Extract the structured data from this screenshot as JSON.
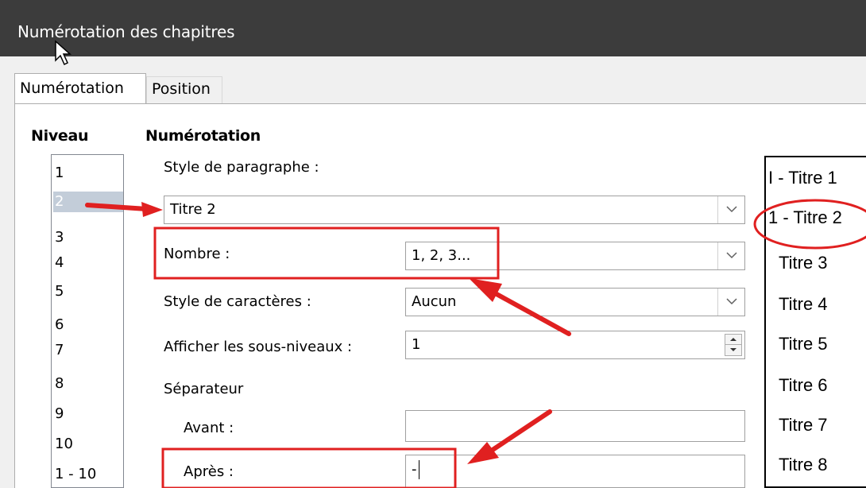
{
  "window": {
    "title": "Numérotation des chapitres"
  },
  "tabs": [
    {
      "label": "Numérotation",
      "active": true
    },
    {
      "label": "Position",
      "active": false
    }
  ],
  "level_section": {
    "heading": "Niveau",
    "items": [
      "1",
      "2",
      "3",
      "4",
      "5",
      "6",
      "7",
      "8",
      "9",
      "10",
      "1 - 10"
    ],
    "selected": "2"
  },
  "numbering_section": {
    "heading": "Numérotation",
    "paragraph_style_label": "Style de paragraphe :",
    "paragraph_style_value": "Titre 2",
    "number_label": "Nombre :",
    "number_value": "1, 2, 3...",
    "char_style_label": "Style de caractères :",
    "char_style_value": "Aucun",
    "sublevels_label": "Afficher les sous-niveaux :",
    "sublevels_value": "1",
    "separator_label": "Séparateur",
    "before_label": "Avant :",
    "before_value": "",
    "after_label": "Après :",
    "after_value": "-"
  },
  "preview": {
    "items": [
      "I - Titre 1",
      "1 - Titre 2",
      "Titre 3",
      "Titre 4",
      "Titre 5",
      "Titre 6",
      "Titre 7",
      "Titre 8"
    ]
  },
  "colors": {
    "annotation": "#e02020",
    "titlebar": "#3c3c3c",
    "selection": "#c3cdd9"
  }
}
